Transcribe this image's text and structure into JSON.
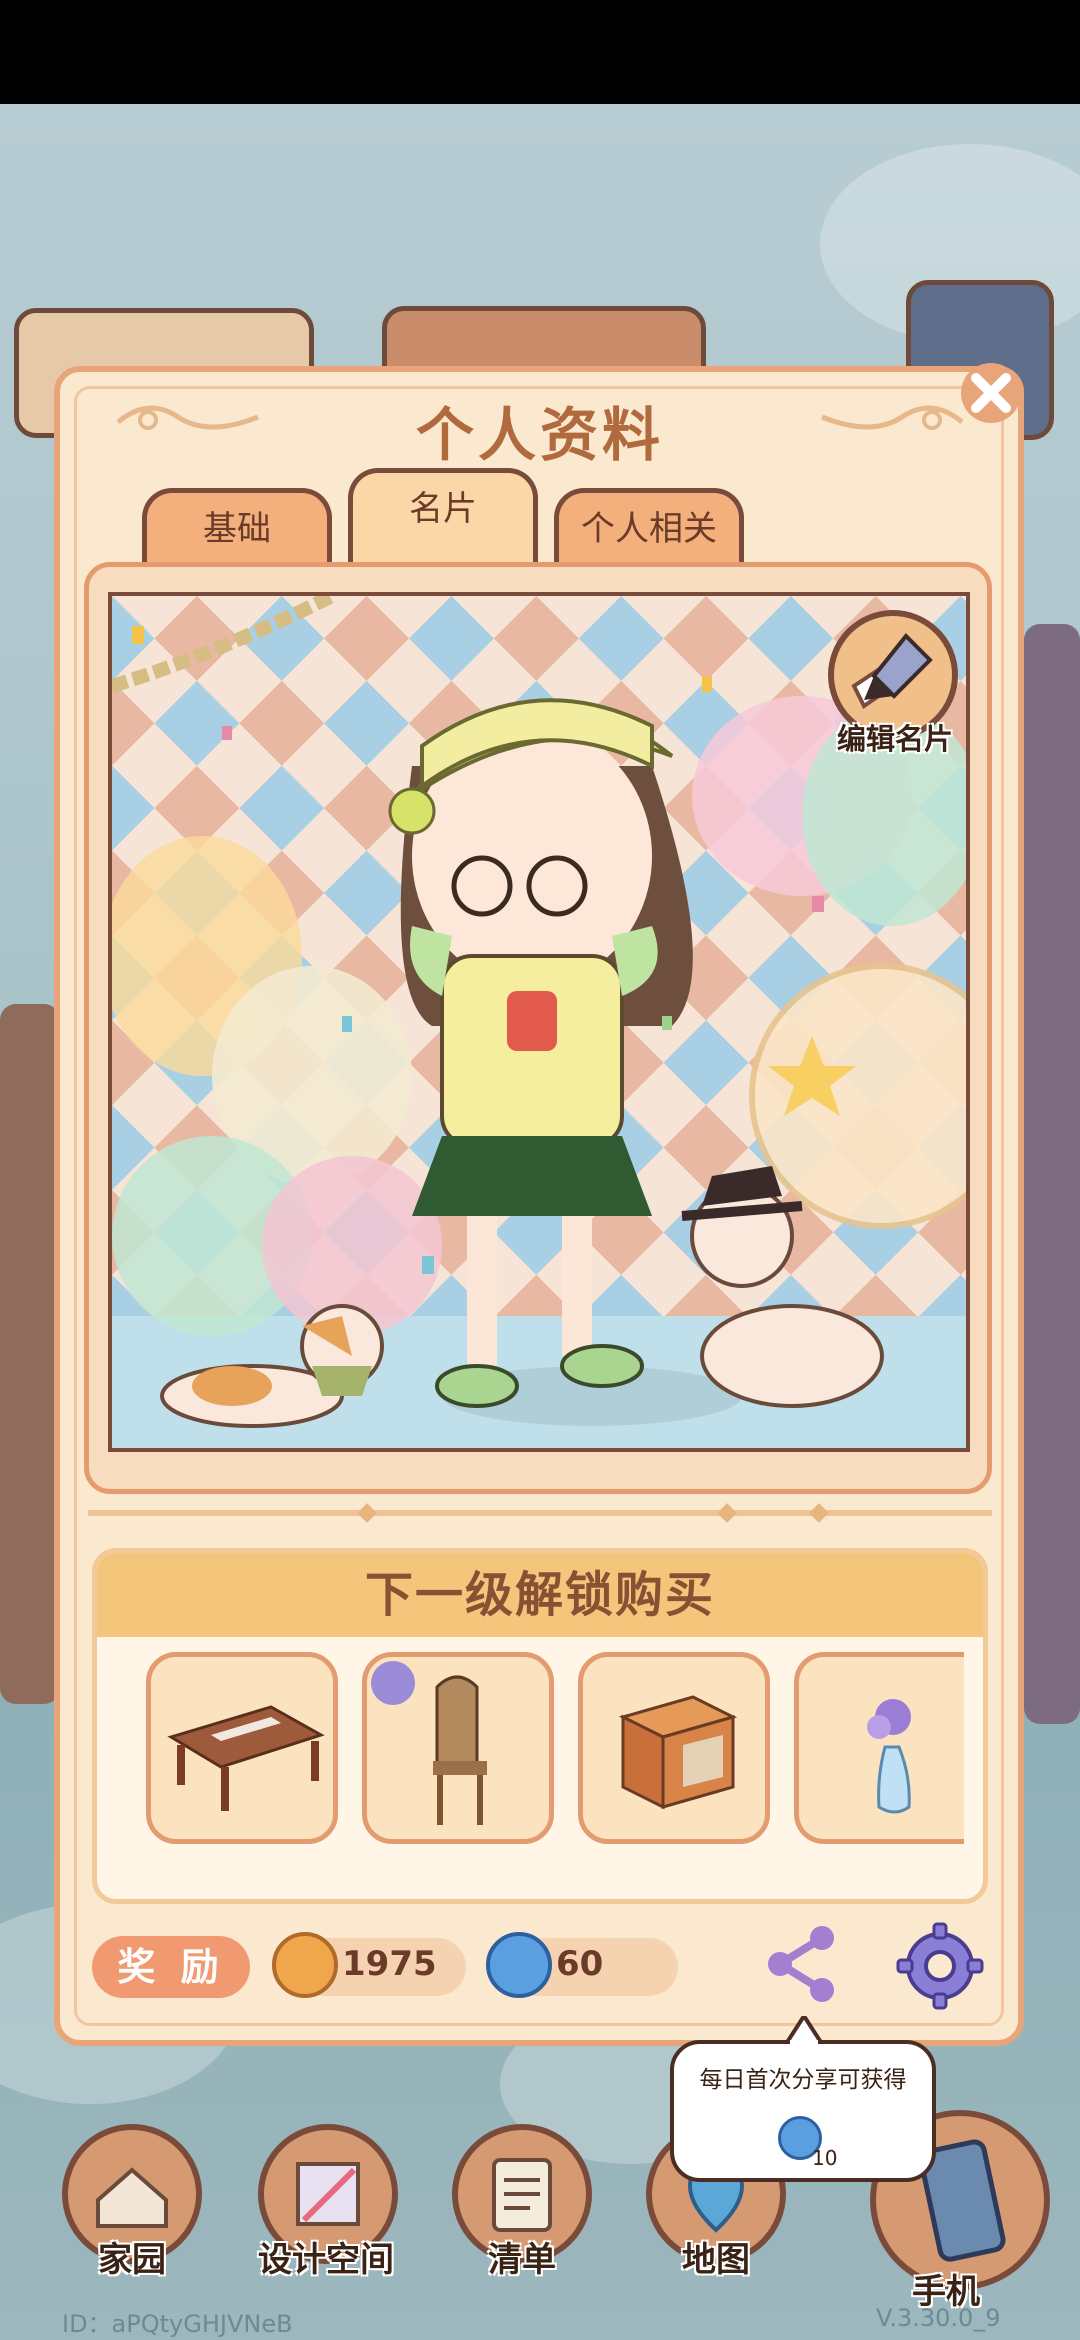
{
  "window": {
    "title": "个人资料"
  },
  "tabs": [
    {
      "label": "基础",
      "active": false
    },
    {
      "label": "名片",
      "active": true
    },
    {
      "label": "个人相关",
      "active": false
    }
  ],
  "card": {
    "edit_label": "编辑名片"
  },
  "unlock": {
    "header": "下一级解锁购买",
    "items": [
      {
        "icon": "table-icon"
      },
      {
        "icon": "chair-icon",
        "badge": "furniture-badge-icon"
      },
      {
        "icon": "cabinet-icon"
      },
      {
        "icon": "flower-vase-icon"
      }
    ]
  },
  "rewards": {
    "label": "奖 励",
    "coins": "1975",
    "gems": "60"
  },
  "share_tooltip": {
    "text": "每日首次分享可获得",
    "amount": "10"
  },
  "nav": [
    {
      "label": "家园",
      "icon": "home-icon"
    },
    {
      "label": "设计空间",
      "icon": "design-space-icon"
    },
    {
      "label": "清单",
      "icon": "list-icon"
    },
    {
      "label": "地图",
      "icon": "map-icon"
    },
    {
      "label": "手机",
      "icon": "phone-icon"
    }
  ],
  "footer": {
    "id": "ID：aPQtyGHJVNeB",
    "version": "V.3.30.0_9"
  },
  "colors": {
    "panel_bg": "#fbe9cf",
    "accent": "#e8a57a",
    "title": "#b1693e",
    "header_bar": "#f4c67c"
  }
}
